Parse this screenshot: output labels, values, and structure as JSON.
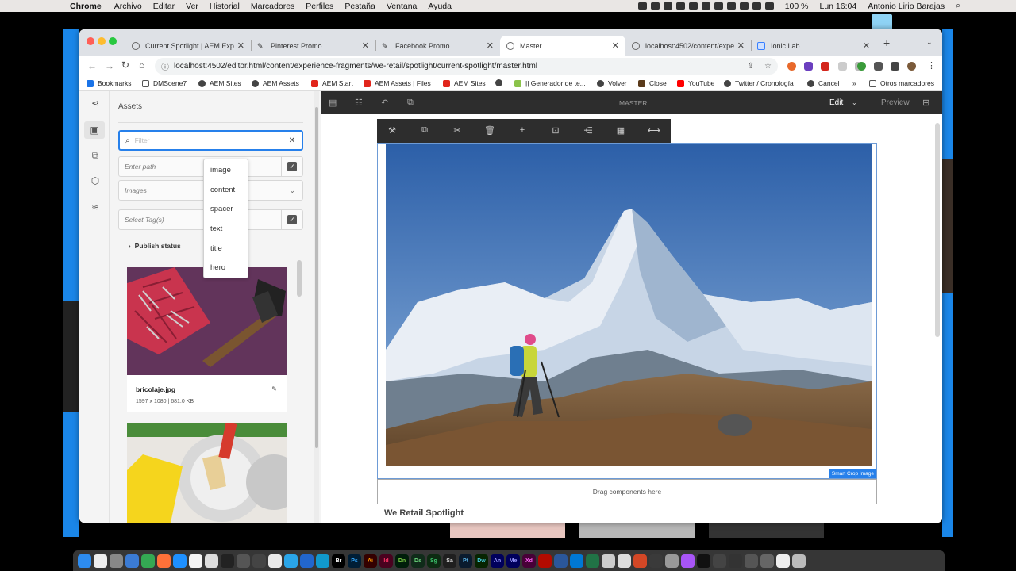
{
  "menubar": {
    "app": "Chrome",
    "items": [
      "Archivo",
      "Editar",
      "Ver",
      "Historial",
      "Marcadores",
      "Perfiles",
      "Pestaña",
      "Ventana",
      "Ayuda"
    ],
    "battery": "100 %",
    "clock": "Lun 16:04",
    "user": "Antonio Lirio Barajas"
  },
  "browser": {
    "tabs": [
      {
        "label": "Current Spotlight | AEM Expe",
        "active": false
      },
      {
        "label": "Pinterest Promo",
        "active": false
      },
      {
        "label": "Facebook Promo",
        "active": false
      },
      {
        "label": "Master",
        "active": true
      },
      {
        "label": "localhost:4502/content/expe",
        "active": false
      },
      {
        "label": "Ionic Lab",
        "active": false
      }
    ],
    "new_tab": "+",
    "url": "localhost:4502/editor.html/content/experience-fragments/we-retail/spotlight/current-spotlight/master.html",
    "bookmarks": [
      "Bookmarks",
      "DMScene7",
      "AEM Sites",
      "AEM Assets",
      "AEM Start",
      "AEM Assets | Files",
      "AEM Sites",
      "|| Generador de te...",
      "Volver",
      "Close",
      "YouTube",
      "Twitter / Cronología",
      "Cancel"
    ],
    "bookmarks_more": "»",
    "other_bookmarks": "Otros marcadores"
  },
  "assets_panel": {
    "title": "Assets",
    "filter_placeholder": "Filter",
    "path_placeholder": "Enter path",
    "type_value": "Images",
    "tags_placeholder": "Select Tag(s)",
    "publish_status": "Publish status",
    "dropdown": [
      "image",
      "content",
      "spacer",
      "text",
      "title",
      "hero"
    ],
    "cards": [
      {
        "name": "bricolaje.jpg",
        "meta": "1597 x 1080 | 681.0 KB"
      },
      {
        "name": "",
        "meta": ""
      }
    ]
  },
  "editor": {
    "fragment_title": "MASTER",
    "mode": "Edit",
    "preview": "Preview",
    "smart_crop": "Smart Crop Image",
    "drag_hint": "Drag components here",
    "spotlight_text": "We Retail Spotlight"
  },
  "colors": {
    "accent": "#2680eb",
    "editor_bar": "#2d2d2d",
    "desktop": "#1a86e8"
  }
}
